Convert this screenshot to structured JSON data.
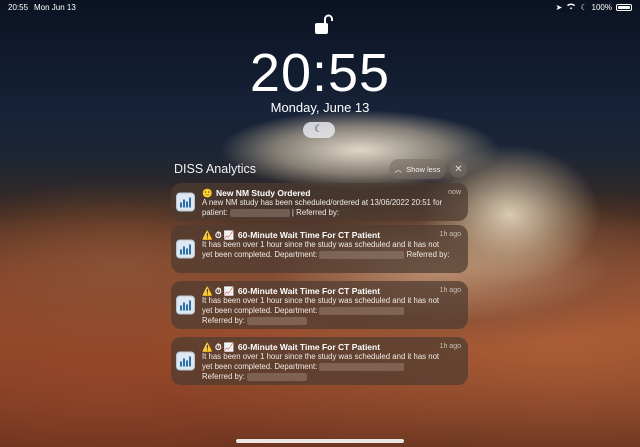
{
  "status_bar": {
    "time": "20:55",
    "date": "Mon Jun 13",
    "battery": "100%"
  },
  "lock_screen": {
    "clock": "20:55",
    "date": "Monday, June 13"
  },
  "notification_group": {
    "app_name": "DISS Analytics",
    "show_less_label": "Show less",
    "close_label": "✕"
  },
  "notifications": [
    {
      "emoji": "🙂",
      "title": "New NM Study Ordered",
      "time": "now",
      "line1": "A new NM study has been scheduled/ordered at 13/06/2022 20:51 for",
      "patient_label": "patient:",
      "sep": "| Referred by:"
    },
    {
      "emoji": "⚠️ ⏱ 📈",
      "title": "60-Minute Wait Time For CT Patient",
      "time": "1h ago",
      "line1": "It has been over 1 hour since the study was scheduled and it has not",
      "line2": "yet been completed. Department:",
      "referred_label": "Referred by:"
    },
    {
      "emoji": "⚠️ ⏱ 📈",
      "title": "60-Minute Wait Time For CT Patient",
      "time": "1h ago",
      "line1": "It has been over 1 hour since the study was scheduled and it has not",
      "line2": "yet been completed. Department:",
      "referred_label": "Referred by:"
    },
    {
      "emoji": "⚠️ ⏱ 📈",
      "title": "60-Minute Wait Time For CT Patient",
      "time": "1h ago",
      "line1": "It has been over 1 hour since the study was scheduled and it has not",
      "line2": "yet been completed. Department:",
      "referred_label": "Referred by:"
    }
  ],
  "icons": {
    "lock": "unlocked-padlock-icon",
    "focus": "moon-icon",
    "app": "diss-analytics-icon"
  }
}
